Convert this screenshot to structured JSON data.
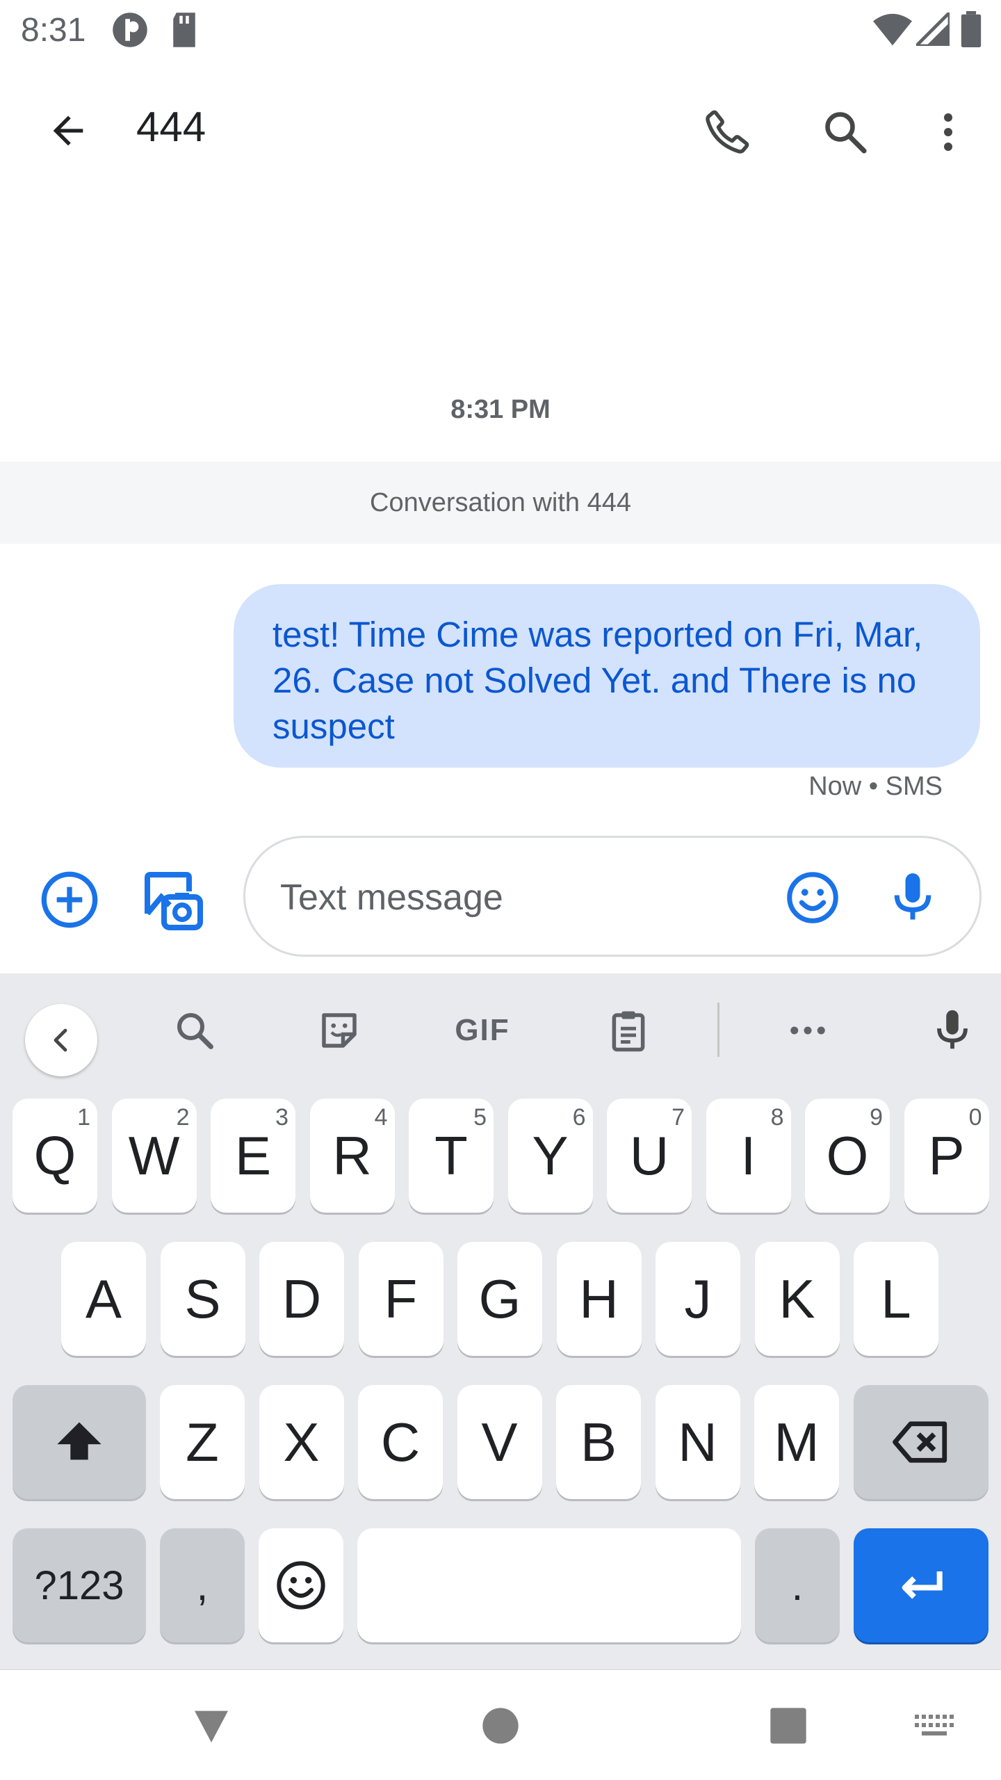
{
  "status_bar": {
    "time": "8:31"
  },
  "app_bar": {
    "title": "444"
  },
  "conversation": {
    "timestamp": "8:31 PM",
    "banner": "Conversation with 444",
    "message": {
      "text": "test! Time Cime was reported on Fri, Mar, 26. Case not Solved Yet. and There is no suspect",
      "meta": "Now • SMS"
    }
  },
  "compose": {
    "placeholder": "Text message"
  },
  "keyboard": {
    "toolbar": {
      "gif_label": "GIF"
    },
    "row1": [
      {
        "label": "Q",
        "hint": "1"
      },
      {
        "label": "W",
        "hint": "2"
      },
      {
        "label": "E",
        "hint": "3"
      },
      {
        "label": "R",
        "hint": "4"
      },
      {
        "label": "T",
        "hint": "5"
      },
      {
        "label": "Y",
        "hint": "6"
      },
      {
        "label": "U",
        "hint": "7"
      },
      {
        "label": "I",
        "hint": "8"
      },
      {
        "label": "O",
        "hint": "9"
      },
      {
        "label": "P",
        "hint": "0"
      }
    ],
    "row2": [
      "A",
      "S",
      "D",
      "F",
      "G",
      "H",
      "J",
      "K",
      "L"
    ],
    "row3": [
      "Z",
      "X",
      "C",
      "V",
      "B",
      "N",
      "M"
    ],
    "row4": {
      "symbols": "?123",
      "comma": ",",
      "period": "."
    }
  },
  "colors": {
    "accent": "#1a73e8",
    "bubble": "#d3e3fd",
    "bubble_text": "#0b57d0"
  },
  "icons": [
    "back-arrow-icon",
    "phone-icon",
    "search-icon",
    "more-vert-icon",
    "add-circle-icon",
    "gallery-camera-icon",
    "emoji-icon",
    "mic-icon"
  ]
}
